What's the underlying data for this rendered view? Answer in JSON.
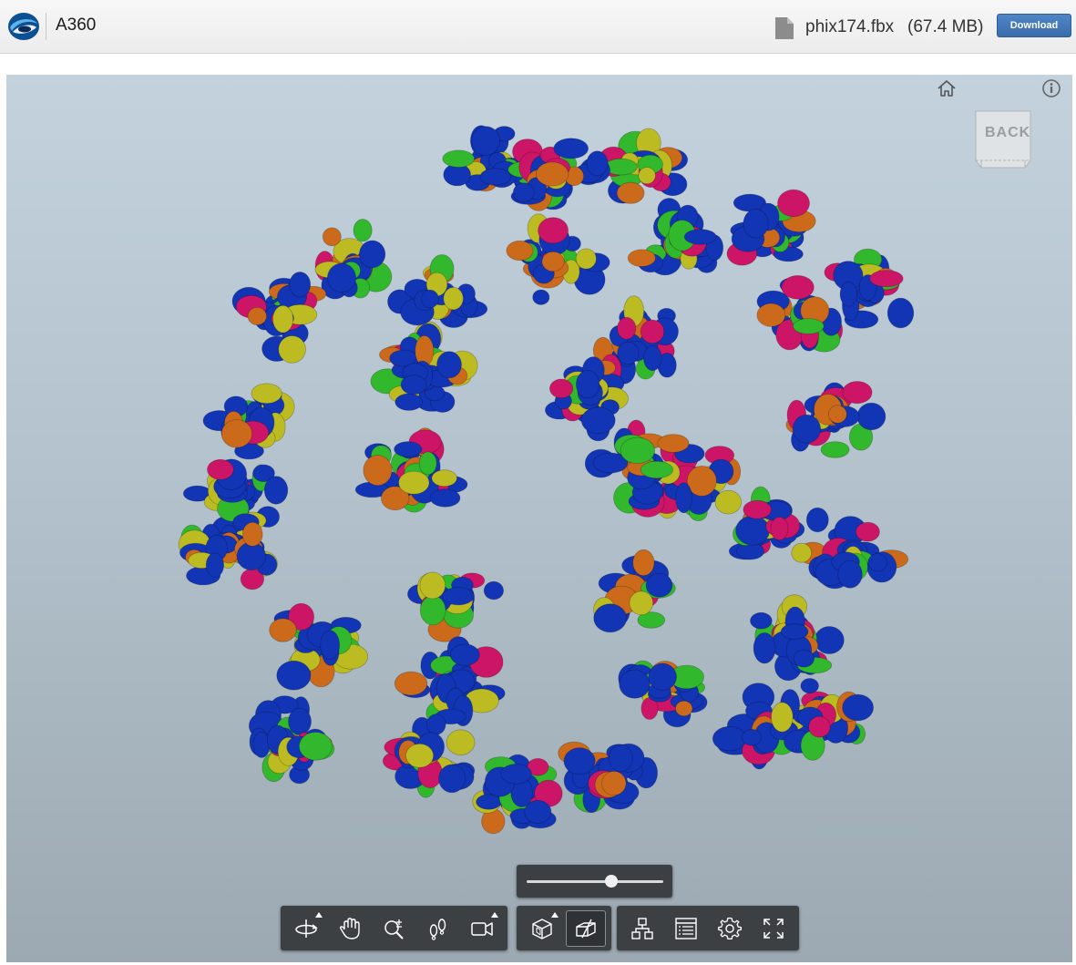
{
  "header": {
    "app_title": "A360",
    "file_name": "phix174.fbx",
    "file_size": "(67.4 MB)",
    "download_label": "Download"
  },
  "viewcube": {
    "face_label": "BACK"
  },
  "explode_slider": {
    "value": 0.62
  },
  "toolbar": {
    "navigation": [
      "orbit-icon",
      "pan-icon",
      "zoom-icon",
      "walk-icon",
      "camera-icon"
    ],
    "model": [
      "explode-icon",
      "section-icon"
    ],
    "settings": [
      "model-browser-icon",
      "properties-icon",
      "settings-gear-icon",
      "fullscreen-icon"
    ]
  },
  "colors": {
    "blue": "#1235b5",
    "green": "#32b82c",
    "magenta": "#cc1566",
    "yellow": "#bcbc22",
    "orange": "#cc6a1c",
    "toolbar_bg": "#3d4042",
    "download_button": "#3a6cab"
  }
}
